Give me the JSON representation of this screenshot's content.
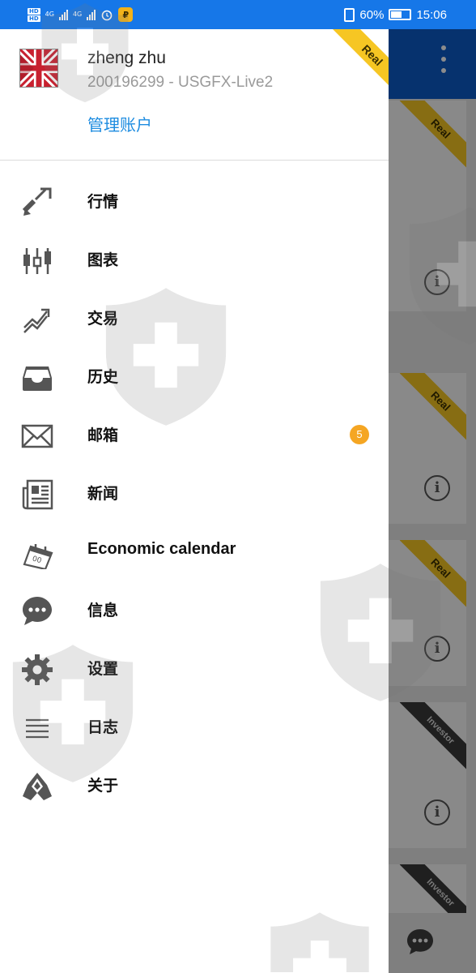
{
  "status_bar": {
    "sim_badges": [
      "HD",
      "HD"
    ],
    "net_labels": [
      "4G",
      "4G"
    ],
    "battery_percent": "60%",
    "battery_level": 0.6,
    "time": "15:06"
  },
  "drawer": {
    "ribbon": "Real",
    "account": {
      "name": "zheng zhu",
      "id_line": "200196299 - USGFX-Live2",
      "manage_label": "管理账户"
    },
    "menu": [
      {
        "label": "行情",
        "icon": "quotes-icon"
      },
      {
        "label": "图表",
        "icon": "chart-icon"
      },
      {
        "label": "交易",
        "icon": "trade-icon"
      },
      {
        "label": "历史",
        "icon": "history-icon"
      },
      {
        "label": "邮箱",
        "icon": "mail-icon",
        "badge": "5"
      },
      {
        "label": "新闻",
        "icon": "news-icon"
      },
      {
        "label": "Economic calendar",
        "icon": "calendar-icon"
      },
      {
        "label": "信息",
        "icon": "chat-icon"
      },
      {
        "label": "设置",
        "icon": "settings-icon"
      },
      {
        "label": "日志",
        "icon": "journal-icon"
      },
      {
        "label": "关于",
        "icon": "about-icon"
      }
    ]
  },
  "background": {
    "card_ribbons": [
      "Real",
      "Real",
      "Real",
      "Investor",
      "Investor"
    ]
  },
  "colors": {
    "status_bar": "#1677e8",
    "toolbar": "#0b5bc8",
    "link": "#1d8ce0",
    "badge": "#f5a623",
    "ribbon_real": "#f6c623"
  }
}
